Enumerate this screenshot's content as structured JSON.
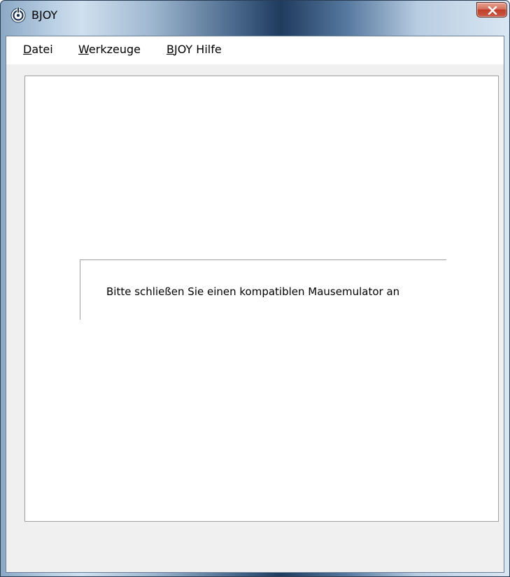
{
  "window": {
    "title": "BJOY",
    "icon": "bjoy-app-icon",
    "close_icon": "close-icon"
  },
  "menubar": {
    "items": [
      {
        "accel": "D",
        "rest": "atei"
      },
      {
        "accel": "W",
        "rest": "erkzeuge"
      },
      {
        "accel": "B",
        "rest": "JOY Hilfe"
      }
    ]
  },
  "main": {
    "message": "Bitte schließen Sie einen kompatiblen Mausemulator an"
  },
  "colors": {
    "close_button": "#c74a36",
    "client_background": "#f0f0f0",
    "panel_border": "#a0a0a0"
  }
}
